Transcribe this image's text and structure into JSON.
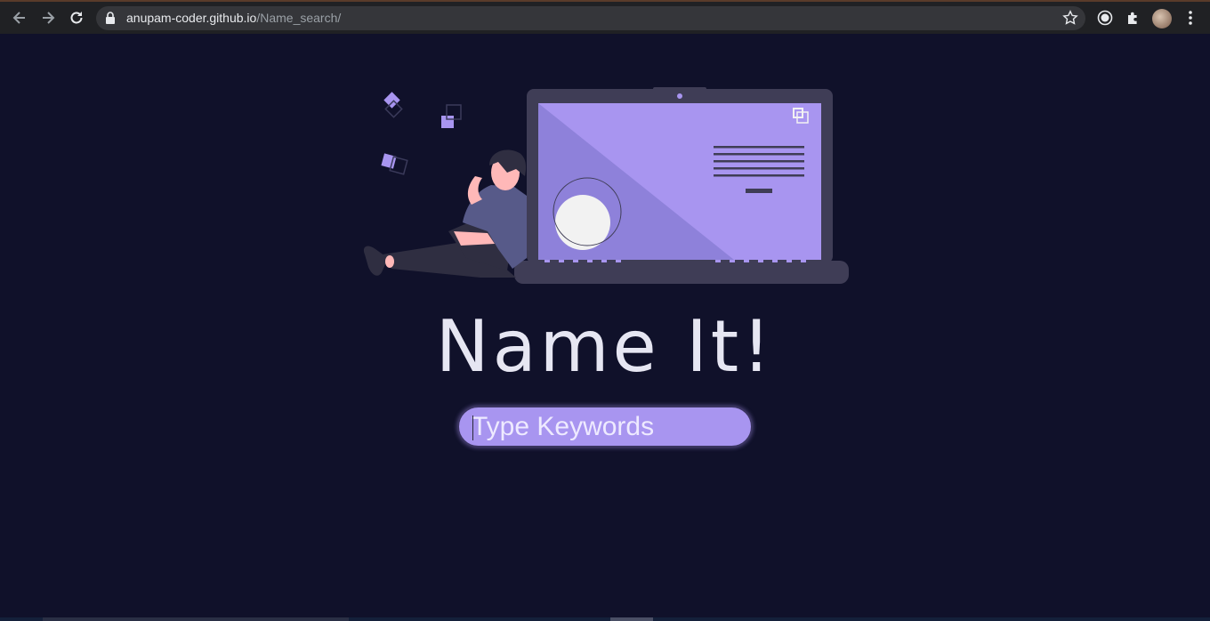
{
  "browser": {
    "url_host": "anupam-coder.github.io",
    "url_path": "/Name_search/",
    "icons": {
      "back": "arrow-left-icon",
      "forward": "arrow-right-icon",
      "reload": "reload-icon",
      "lock": "lock-icon",
      "bookmark": "star-icon",
      "extension1": "record-icon",
      "extensions": "puzzle-icon",
      "menu": "more-vertical-icon"
    }
  },
  "page": {
    "title": "Name It!",
    "search": {
      "placeholder": "Type Keywords",
      "value": ""
    }
  },
  "colors": {
    "background": "#10112a",
    "accent": "#a895f0",
    "laptop_body": "#3f3d56",
    "title": "#e6e6f2"
  }
}
